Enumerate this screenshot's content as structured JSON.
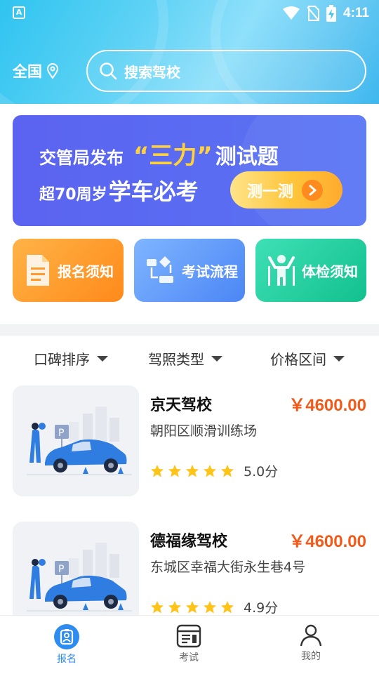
{
  "status": {
    "time": "4:11",
    "left_icon": "A"
  },
  "header": {
    "region": "全国",
    "search_placeholder": "搜索驾校"
  },
  "banner": {
    "line1_prefix": "交管局发布",
    "line1_highlight": "“三力”",
    "line1_suffix": "测试题",
    "line2_prefix": "超70周岁",
    "line2_suffix": "学车必考",
    "button_label": "测一测"
  },
  "quick_links": [
    {
      "label": "报名须知",
      "icon": "document-icon",
      "color": "#ff8a1a"
    },
    {
      "label": "考试流程",
      "icon": "flowchart-icon",
      "color": "#4b86f5"
    },
    {
      "label": "体检须知",
      "icon": "fitness-icon",
      "color": "#12c08e"
    }
  ],
  "filters": [
    "口碑排序",
    "驾照类型",
    "价格区间"
  ],
  "schools": [
    {
      "name": "京天驾校",
      "price": "￥4600.00",
      "address": "朝阳区顺滑训练场",
      "stars": 5,
      "score": "5.0分"
    },
    {
      "name": "德福缘驾校",
      "price": "￥4600.00",
      "address": "东城区幸福大街永生巷4号",
      "stars": 5,
      "score": "4.9分"
    }
  ],
  "tabs": [
    {
      "label": "报名",
      "icon": "badge-icon",
      "active": true
    },
    {
      "label": "考试",
      "icon": "exam-icon",
      "active": false
    },
    {
      "label": "我的",
      "icon": "user-icon",
      "active": false
    }
  ],
  "colors": {
    "accent": "#2d8cf0",
    "price": "#f25a1a",
    "star": "#ffc41a"
  }
}
